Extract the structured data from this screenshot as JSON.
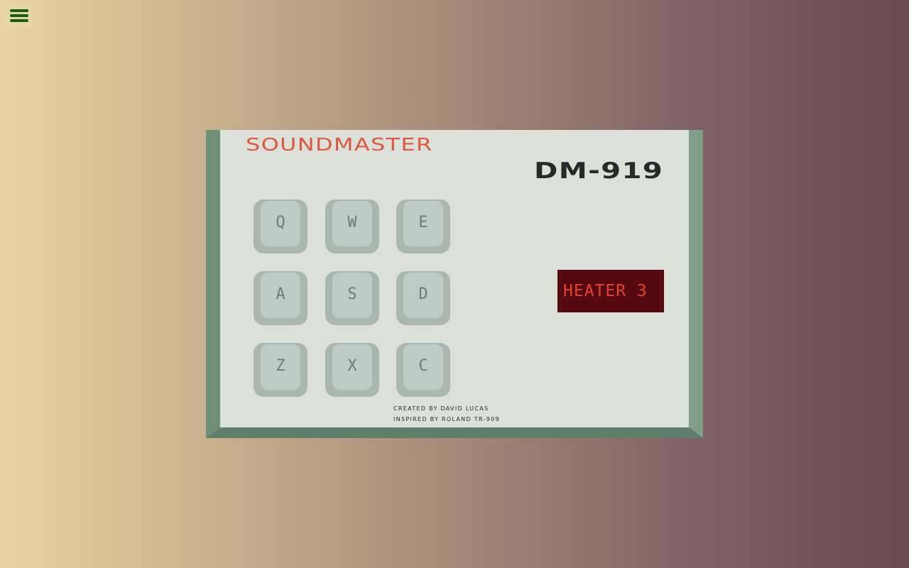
{
  "menu": {
    "icon": "hamburger-menu-icon",
    "icon_color": "#1a5e16"
  },
  "device": {
    "brand": "SOUNDMASTER",
    "model": "DM-919",
    "display_text": "HEATER 3",
    "credit_line1": "CREATED BY DAVID LUCAS",
    "credit_line2": "INSPIRED BY ROLAND TR-909",
    "pads": [
      {
        "key": "Q"
      },
      {
        "key": "W"
      },
      {
        "key": "E"
      },
      {
        "key": "A"
      },
      {
        "key": "S"
      },
      {
        "key": "D"
      },
      {
        "key": "Z"
      },
      {
        "key": "X"
      },
      {
        "key": "C"
      }
    ],
    "colors": {
      "brand": "#e0583b",
      "display_bg": "#550a10",
      "display_text": "#e2442c",
      "face": "#dbe1d9",
      "bevel": "#6f8f77"
    }
  }
}
